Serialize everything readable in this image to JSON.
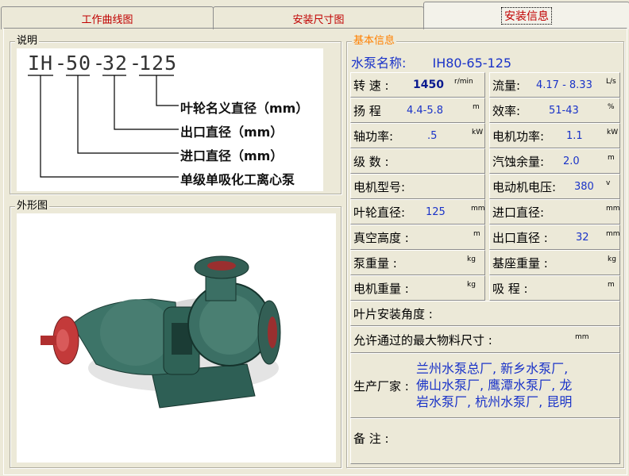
{
  "tabs": [
    {
      "label": "工作曲线图"
    },
    {
      "label": "安装尺寸图"
    },
    {
      "label": "安装信息"
    }
  ],
  "naming": {
    "group_title": "说明",
    "code_parts": [
      "IH",
      "50",
      "32",
      "125"
    ],
    "descriptions": [
      "叶轮名义直径（mm）",
      "出口直径（mm）",
      "进口直径（mm）",
      "单级单吸化工离心泵"
    ]
  },
  "photo": {
    "group_title": "外形图"
  },
  "info": {
    "group_title": "基本信息",
    "pump_name_label": "水泵名称:",
    "pump_name_value": "IH80-65-125",
    "rows": [
      {
        "left_label": "转 速 :",
        "left_value": "1450",
        "left_unit": "r/min",
        "right_label": "流量:",
        "right_value": "4.17 - 8.33",
        "right_unit": "L/s"
      },
      {
        "left_label": "扬 程",
        "left_value": "4.4-5.8",
        "left_unit": "m",
        "right_label": "效率:",
        "right_value": "51-43",
        "right_unit": "%"
      },
      {
        "left_label": "轴功率:",
        "left_value": ".5",
        "left_unit": "kW",
        "right_label": "电机功率:",
        "right_value": "1.1",
        "right_unit": "kW"
      },
      {
        "left_label": "级 数 :",
        "left_value": "",
        "left_unit": "",
        "right_label": "汽蚀余量:",
        "right_value": "2.0",
        "right_unit": "m"
      },
      {
        "left_label": "电机型号:",
        "left_value": "",
        "left_unit": "",
        "right_label": "电动机电压:",
        "right_value": "380",
        "right_unit": "v"
      },
      {
        "left_label": "叶轮直径:",
        "left_value": "125",
        "left_unit": "mm",
        "right_label": "进口直径:",
        "right_value": "",
        "right_unit": "mm"
      },
      {
        "left_label": "真空高度 :",
        "left_value": "",
        "left_unit": "m",
        "right_label": "出口直径 :",
        "right_value": "32",
        "right_unit": "mm"
      },
      {
        "left_label": "泵重量 :",
        "left_value": "",
        "left_unit": "kg",
        "right_label": "基座重量 :",
        "right_value": "",
        "right_unit": "kg"
      },
      {
        "left_label": "电机重量 :",
        "left_value": "",
        "left_unit": "kg",
        "right_label": "吸 程 :",
        "right_value": "",
        "right_unit": "m"
      }
    ],
    "blade_angle_label": "叶片安装角度 :",
    "max_particle_label": "允许通过的最大物料尺寸 :",
    "max_particle_unit": "mm",
    "manufacturer_label": "生产厂家 :",
    "manufacturer_lines": [
      "兰州水泵总厂, 新乡水泵厂,",
      "佛山水泵厂, 鹰潭水泵厂, 龙",
      "岩水泵厂, 杭州水泵厂, 昆明"
    ],
    "remarks_label": "备 注 :"
  }
}
